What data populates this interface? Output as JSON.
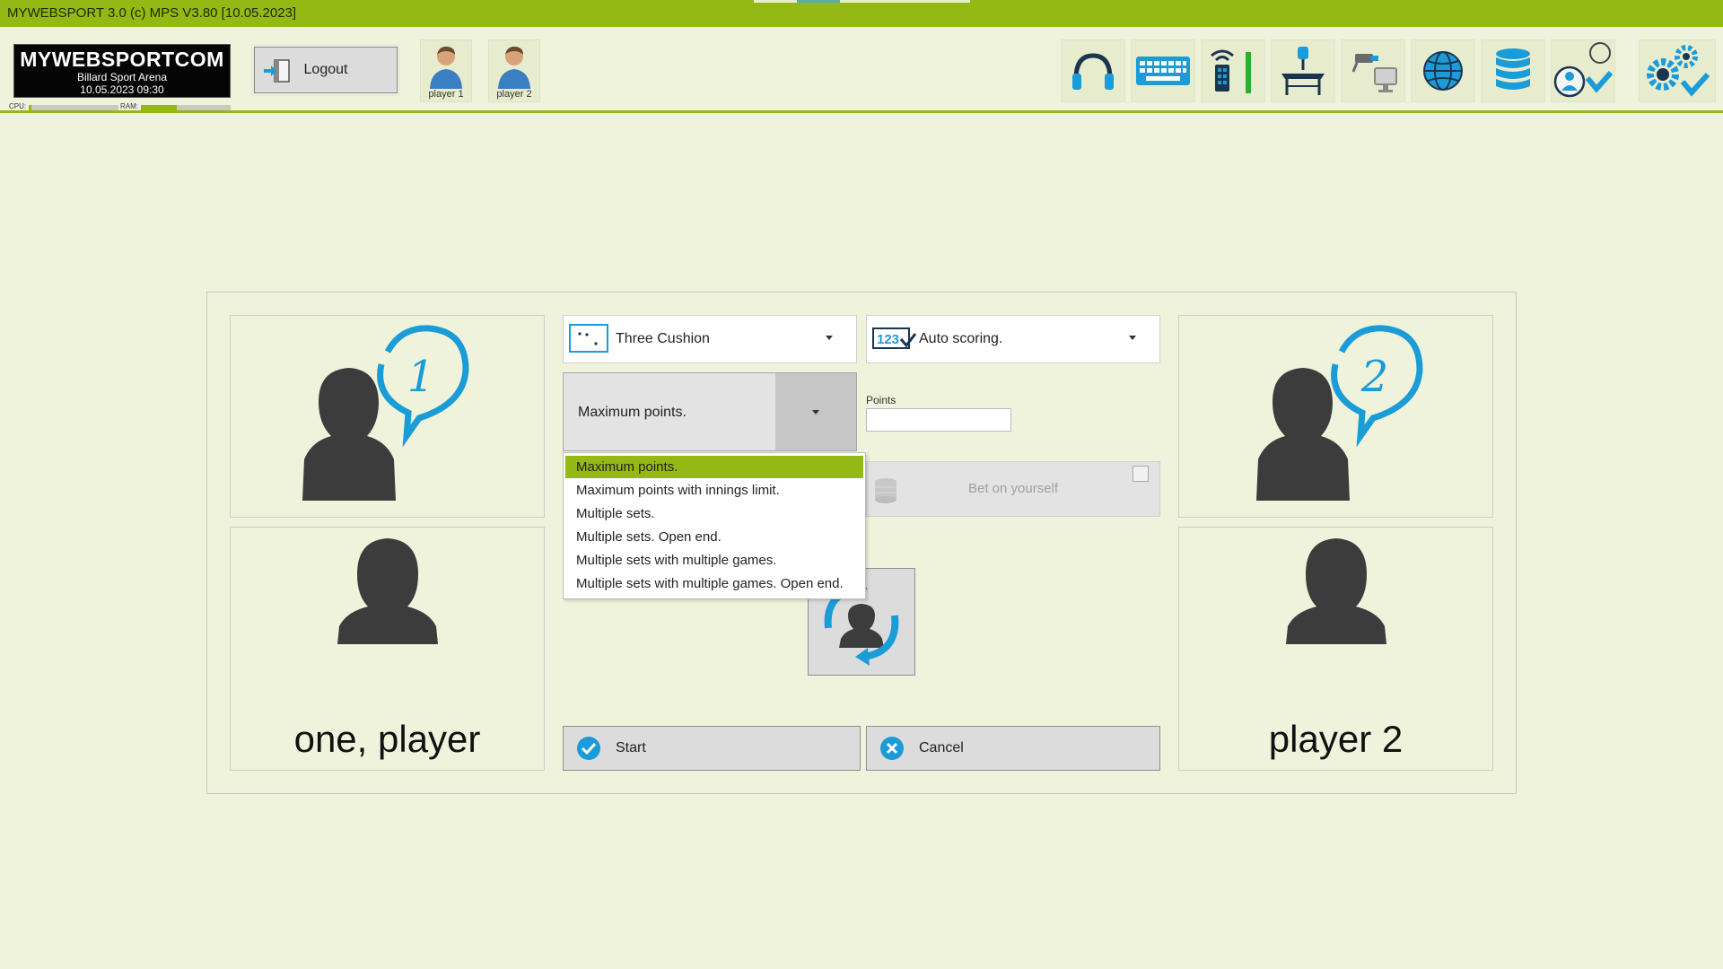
{
  "window": {
    "title": "MYWEBSPORT 3.0  (c) MPS V3.80 [10.05.2023]"
  },
  "colors": {
    "accent": "#94b814",
    "background": "#eff3db",
    "icon_blue": "#1a9cd8"
  },
  "header": {
    "logo": {
      "brand": "MYWEBSPORTCOM",
      "venue": "Billard Sport Arena",
      "datetime": "10.05.2023  09:30"
    },
    "cpu_label": "CPU:",
    "ram_label": "RAM:",
    "cpu_fraction": 0.03,
    "ram_fraction": 0.4,
    "logout_label": "Logout",
    "players": [
      {
        "label": "player 1"
      },
      {
        "label": "player 2"
      }
    ],
    "tools": [
      "headphones-icon",
      "keyboard-icon",
      "remote-signal-icon",
      "table-lamp-icon",
      "camera-monitor-icon",
      "globe-icon",
      "database-icon",
      "user-check-icon",
      "settings-check-icon"
    ]
  },
  "match": {
    "player1": {
      "name": "one, player",
      "badge": "1"
    },
    "player2": {
      "name": "player 2",
      "badge": "2"
    },
    "discipline": {
      "selected": "Three Cushion"
    },
    "scoring": {
      "selected": "Auto scoring.",
      "icon_text": "123"
    },
    "mode": {
      "selected": "Maximum points.",
      "options": [
        "Maximum points.",
        "Maximum points with innings limit.",
        "Multiple sets.",
        "Multiple sets. Open end.",
        "Multiple sets with multiple games.",
        "Multiple sets with multiple games. Open end."
      ]
    },
    "points": {
      "label": "Points",
      "value": ""
    },
    "bet": {
      "label": "Bet on yourself",
      "checked": false
    },
    "start_label": "Start",
    "cancel_label": "Cancel"
  }
}
